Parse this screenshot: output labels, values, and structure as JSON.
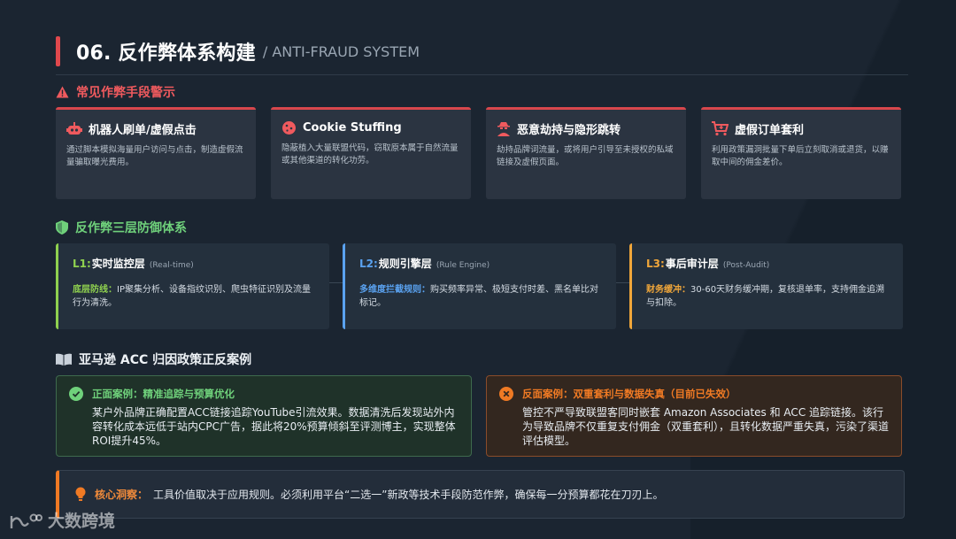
{
  "header": {
    "title": "06. 反作弊体系构建",
    "subtitle": "/ ANTI-FRAUD SYSTEM"
  },
  "fraud_section": {
    "heading": "常见作弊手段警示",
    "cards": [
      {
        "icon": "robot-icon",
        "title": "机器人刷单/虚假点击",
        "desc": "通过脚本模拟海量用户访问与点击，制造虚假流量骗取曝光费用。"
      },
      {
        "icon": "cookie-icon",
        "title": "Cookie Stuffing",
        "desc": "隐蔽植入大量联盟代码，窃取原本属于自然流量或其他渠道的转化功劳。"
      },
      {
        "icon": "user-secret-icon",
        "title": "恶意劫持与隐形跳转",
        "desc": "劫持品牌词流量，或将用户引导至未授权的私域链接及虚假页面。"
      },
      {
        "icon": "cart-icon",
        "title": "虚假订单套利",
        "desc": "利用政策漏洞批量下单后立刻取消或退货，以赚取中间的佣金差价。"
      }
    ]
  },
  "defense_section": {
    "heading": "反作弊三层防御体系",
    "layers": [
      {
        "level": "L1:",
        "name": "实时监控层",
        "en": "(Real-time)",
        "key": "底层防线：",
        "text": "IP聚集分析、设备指纹识别、爬虫特征识别及流量行为清洗。",
        "color": "#8fd14f"
      },
      {
        "level": "L2:",
        "name": "规则引擎层",
        "en": "(Rule Engine)",
        "key": "多维度拦截规则：",
        "text": "购买频率异常、极短支付时差、黑名单比对标记。",
        "color": "#5aa2f0"
      },
      {
        "level": "L3:",
        "name": "事后审计层",
        "en": "(Post-Audit)",
        "key": "财务缓冲：",
        "text": "30-60天财务缓冲期，复核退单率，支持佣金追溯与扣除。",
        "color": "#f0a63a"
      }
    ]
  },
  "case_section": {
    "heading": "亚马逊 ACC 归因政策正反案例",
    "positive": {
      "title": "正面案例：精准追踪与预算优化",
      "body": "某户外品牌正确配置ACC链接追踪YouTube引流效果。数据清洗后发现站外内容转化成本远低于站内CPC广告，据此将20%预算倾斜至评测博主，实现整体ROI提升45%。"
    },
    "negative": {
      "title": "反面案例：双重套利与数据失真（目前已失效）",
      "body": "管控不严导致联盟客同时嵌套 Amazon Associates 和 ACC 追踪链接。该行为导致品牌不仅重复支付佣金（双重套利），且转化数据严重失真，污染了渠道评估模型。"
    }
  },
  "insight": {
    "label": "核心洞察：",
    "text": "工具价值取决于应用规则。必须利用平台“二选一”新政等技术手段防范作弊，确保每一分预算都花在刀刃上。"
  },
  "watermark": "大数跨境",
  "colors": {
    "accent_red": "#e0484d",
    "positive_green": "#6fd17b",
    "negative_orange": "#f07a24"
  }
}
